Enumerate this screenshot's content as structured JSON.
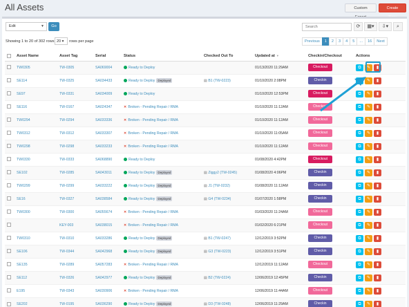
{
  "page": {
    "title": "All Assets"
  },
  "header": {
    "custom_export": "Custom Export",
    "create_new": "Create New"
  },
  "toolbar": {
    "bulk_action": "Edit",
    "go": "Go",
    "search_placeholder": "Search"
  },
  "pagination": {
    "showing": "Showing 1 to 20 of 302 rows",
    "per_page": "20",
    "rows_per_page": "rows per page",
    "previous": "Previous",
    "pages": [
      "1",
      "2",
      "3",
      "4",
      "5",
      "...",
      "16"
    ],
    "next": "Next",
    "active_page": "1"
  },
  "table": {
    "columns": [
      "Asset Name",
      "Asset Tag",
      "Serial",
      "Status",
      "Checked Out To",
      "Updated at",
      "Checkin/Checkout",
      "Actions"
    ],
    "rows": [
      {
        "name": "TW0305",
        "tag": "TW-0305",
        "serial": "SA069004",
        "status": "Ready to Deploy",
        "status_type": "ready",
        "deployed": "",
        "checked_out": "",
        "updated": "01/13/2020 11:29AM",
        "btn": "Checkout",
        "btn_color": "red"
      },
      {
        "name": "SE114",
        "tag": "TW-0325",
        "serial": "SA034433",
        "status": "Ready to Deploy",
        "status_type": "ready",
        "deployed": "Deployed",
        "checked_out": "B1 (TW-0223)",
        "updated": "01/10/2020 2:08PM",
        "btn": "Checkin",
        "btn_color": "purple"
      },
      {
        "name": "SE97",
        "tag": "TW-0331",
        "serial": "SA034009",
        "status": "Ready to Deploy",
        "status_type": "ready",
        "deployed": "",
        "checked_out": "",
        "updated": "01/10/2020 12:53PM",
        "btn": "Checkout",
        "btn_color": "red"
      },
      {
        "name": "SE116",
        "tag": "TW-0167",
        "serial": "SA024347",
        "status": "Broken - Pending Repair / RMA",
        "status_type": "broken",
        "deployed": "",
        "checked_out": "",
        "updated": "01/10/2020 11:12AM",
        "btn": "Checkout",
        "btn_color": "pink"
      },
      {
        "name": "TW0294",
        "tag": "TW-0294",
        "serial": "SA033336",
        "status": "Broken - Pending Repair / RMA",
        "status_type": "broken",
        "deployed": "",
        "checked_out": "",
        "updated": "01/10/2020 11:12AM",
        "btn": "Checkout",
        "btn_color": "pink"
      },
      {
        "name": "TW0312",
        "tag": "TW-0312",
        "serial": "SA033307",
        "status": "Broken - Pending Repair / RMA",
        "status_type": "broken",
        "deployed": "",
        "checked_out": "",
        "updated": "01/10/2020 11:05AM",
        "btn": "Checkout",
        "btn_color": "pink"
      },
      {
        "name": "TW0298",
        "tag": "TW-0298",
        "serial": "SA033233",
        "status": "Broken - Pending Repair / RMA",
        "status_type": "broken",
        "deployed": "",
        "checked_out": "",
        "updated": "01/10/2020 11:12AM",
        "btn": "Checkout",
        "btn_color": "pink"
      },
      {
        "name": "TW0330",
        "tag": "TW-0333",
        "serial": "SA068890",
        "status": "Ready to Deploy",
        "status_type": "ready",
        "deployed": "",
        "checked_out": "",
        "updated": "01/08/2020 4:42PM",
        "btn": "Checkout",
        "btn_color": "red"
      },
      {
        "name": "SE102",
        "tag": "TW-0285",
        "serial": "SA043011",
        "status": "Ready to Deploy",
        "status_type": "ready",
        "deployed": "Deployed",
        "checked_out": "Ziggy2 (TW-0245)",
        "updated": "01/08/2020 4:06PM",
        "btn": "Checkin",
        "btn_color": "purple"
      },
      {
        "name": "TW0299",
        "tag": "TW-0299",
        "serial": "SA033222",
        "status": "Ready to Deploy",
        "status_type": "ready",
        "deployed": "Deployed",
        "checked_out": "J1 (TW-0232)",
        "updated": "01/08/2020 11:12AM",
        "btn": "Checkin",
        "btn_color": "purple"
      },
      {
        "name": "SE16",
        "tag": "TW-0327",
        "serial": "SA038584",
        "status": "Ready to Deploy",
        "status_type": "ready",
        "deployed": "Deployed",
        "checked_out": "G4 (TW-0234)",
        "updated": "01/07/2020 1:58PM",
        "btn": "Checkin",
        "btn_color": "purple"
      },
      {
        "name": "TW0300",
        "tag": "TW-0300",
        "serial": "SA055674",
        "status": "Broken - Pending Repair / RMA",
        "status_type": "broken",
        "deployed": "",
        "checked_out": "",
        "updated": "01/03/2020 11:24AM",
        "btn": "Checkout",
        "btn_color": "pink"
      },
      {
        "name": "",
        "tag": "KEY-003",
        "serial": "SA038015",
        "status": "Broken - Pending Repair / RMA",
        "status_type": "broken",
        "deployed": "",
        "checked_out": "",
        "updated": "01/02/2020 6:21PM",
        "btn": "Checkout",
        "btn_color": "pink"
      },
      {
        "name": "TW0310",
        "tag": "TW-0310",
        "serial": "SA033286",
        "status": "Ready to Deploy",
        "status_type": "ready",
        "deployed": "Deployed",
        "checked_out": "B1 (TW-0247)",
        "updated": "12/12/2019 3:52PM",
        "btn": "Checkin",
        "btn_color": "purple"
      },
      {
        "name": "SE106",
        "tag": "TW-0344",
        "serial": "SA042968",
        "status": "Ready to Deploy",
        "status_type": "ready",
        "deployed": "Deployed",
        "checked_out": "G3 (TW-0223)",
        "updated": "12/12/2019 3:51PM",
        "btn": "Checkin",
        "btn_color": "purple"
      },
      {
        "name": "SE135",
        "tag": "TW-0289",
        "serial": "SA057283",
        "status": "Broken - Pending Repair / RMA",
        "status_type": "broken",
        "deployed": "",
        "checked_out": "",
        "updated": "12/12/2019 11:12AM",
        "btn": "Checkout",
        "btn_color": "pink"
      },
      {
        "name": "SE112",
        "tag": "TW-0326",
        "serial": "SA042977",
        "status": "Ready to Deploy",
        "status_type": "ready",
        "deployed": "Deployed",
        "checked_out": "B2 (TW-0224)",
        "updated": "12/06/2019 12:45PM",
        "btn": "Checkin",
        "btn_color": "purple"
      },
      {
        "name": "E195",
        "tag": "TW-0343",
        "serial": "SA030906",
        "status": "Broken - Pending Repair / RMA",
        "status_type": "broken",
        "deployed": "",
        "checked_out": "",
        "updated": "12/06/2019 11:44AM",
        "btn": "Checkout",
        "btn_color": "pink"
      },
      {
        "name": "SE202",
        "tag": "TW-0195",
        "serial": "SA036290",
        "status": "Ready to Deploy",
        "status_type": "ready",
        "deployed": "Deployed",
        "checked_out": "D3 (TW-0248)",
        "updated": "12/06/2019 11:29AM",
        "btn": "Checkin",
        "btn_color": "purple"
      }
    ]
  },
  "colors": {
    "primary": "#3c8dbc",
    "danger": "#dd4b39",
    "checkout_red": "#d81b60",
    "checkout_pink": "#f1699a",
    "checkin_purple": "#605ca8",
    "edit_orange": "#f39c12",
    "clone_cyan": "#00c0ef"
  },
  "icons": [
    "refresh-icon",
    "columns-icon",
    "export-icon",
    "zoom-icon",
    "clone-icon",
    "pencil-icon",
    "trash-icon",
    "user-icon",
    "caret-down-icon"
  ]
}
